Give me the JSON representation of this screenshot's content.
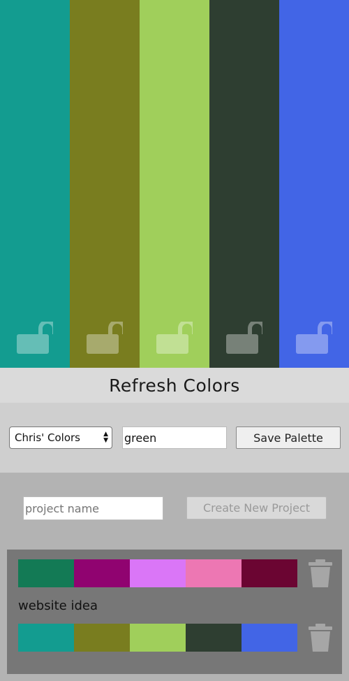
{
  "main_palette": {
    "colors": [
      "#139c90",
      "#797d1f",
      "#a0cf5b",
      "#2e3e31",
      "#4265e6"
    ],
    "lock_icon": "unlocked-padlock-icon",
    "locked": [
      false,
      false,
      false,
      false,
      false
    ]
  },
  "refresh": {
    "label": "Refresh Colors"
  },
  "save": {
    "project_select_value": "Chris' Colors",
    "palette_name_value": "green",
    "save_label": "Save Palette"
  },
  "project": {
    "name_placeholder": "project name",
    "create_label": "Create New Project"
  },
  "saved_palettes": [
    {
      "name": "",
      "colors": [
        "#137a55",
        "#900370",
        "#da76f7",
        "#ed77b3",
        "#6b0532"
      ],
      "delete_icon": "trash-icon"
    },
    {
      "name": "website idea",
      "colors": [
        "#139c90",
        "#797d1f",
        "#a0cf5b",
        "#2e3e31",
        "#4265e6"
      ],
      "delete_icon": "trash-icon"
    }
  ]
}
